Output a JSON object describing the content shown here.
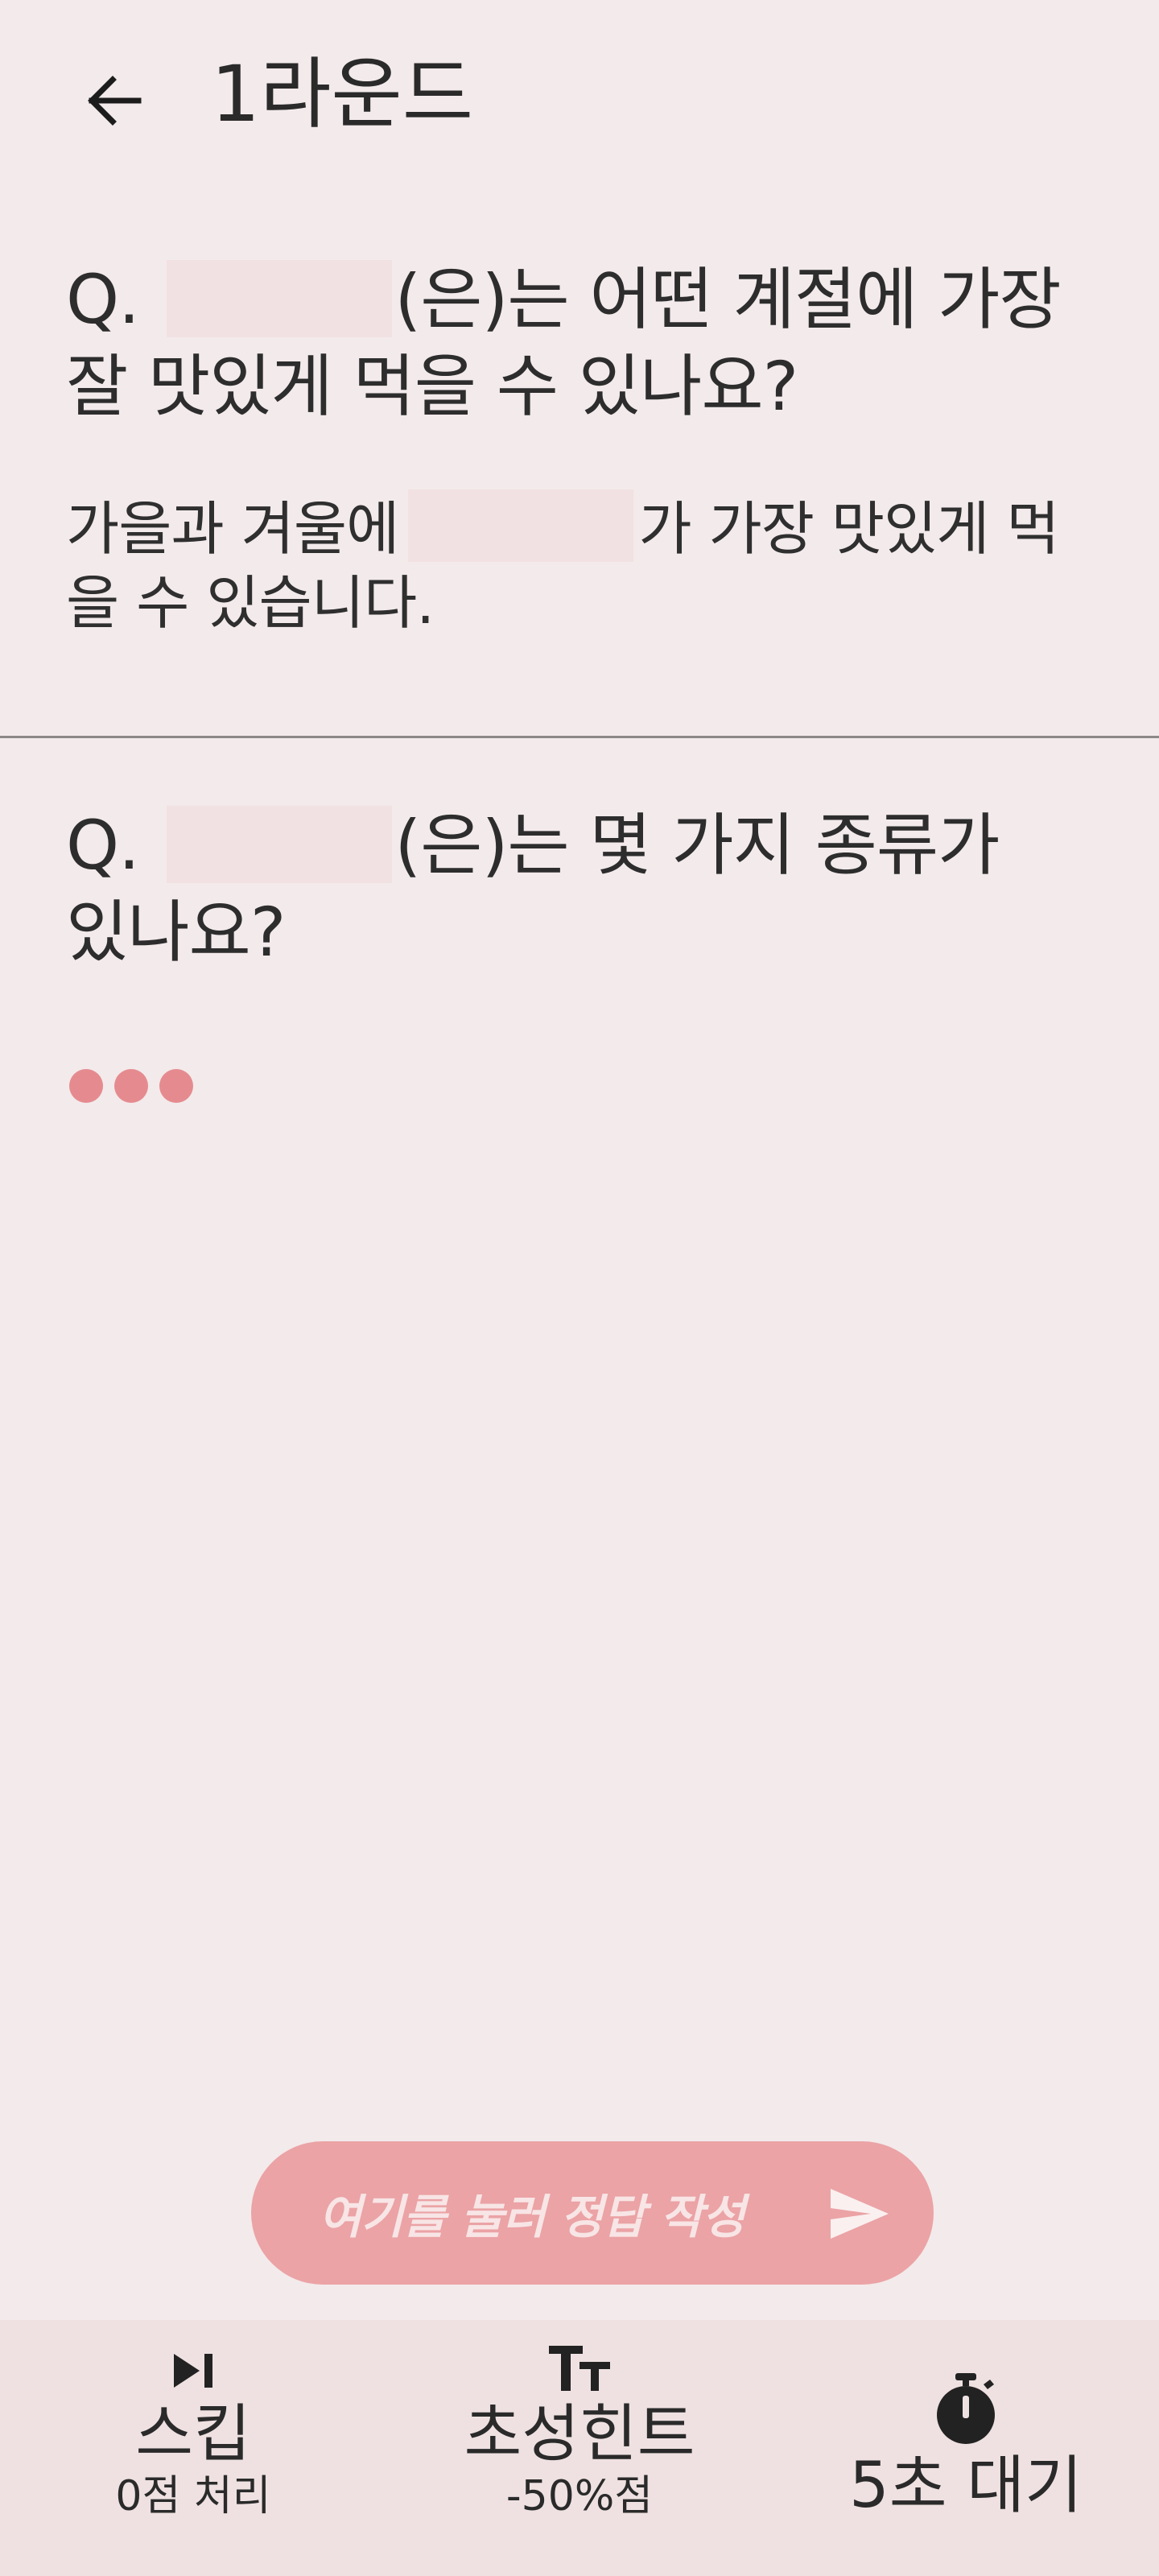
{
  "header": {
    "title": "1라운드",
    "back_icon": "arrow-left-icon"
  },
  "qa": [
    {
      "question_prefix": "Q.",
      "question_suffix": "(은)는 어떤 계절에 가장 잘 맛있게 먹을 수 있나요?",
      "answer_prefix": "가을과 겨울에",
      "answer_suffix": "가 가장 맛있게 먹을 수 있습니다."
    },
    {
      "question_prefix": "Q.",
      "question_suffix": "(은)는 몇 가지 종류가 있나요?",
      "answer_status": "typing"
    }
  ],
  "input": {
    "placeholder": "여기를 눌러 정답 작성",
    "send_icon": "send-icon"
  },
  "bottom_bar": {
    "skip": {
      "label": "스킵",
      "sub": "0점 처리",
      "icon": "skip-next-icon"
    },
    "hint": {
      "label": "초성힌트",
      "sub": "-50%점",
      "icon": "text-size-icon"
    },
    "wait": {
      "label": "5초 대기",
      "icon": "stopwatch-icon"
    }
  },
  "colors": {
    "background": "#f3eaeb",
    "accent": "#eba3a5",
    "typing_dot": "#e58b8f",
    "bottom_bar": "#efe1e2",
    "blank": "#f2e1e2"
  }
}
